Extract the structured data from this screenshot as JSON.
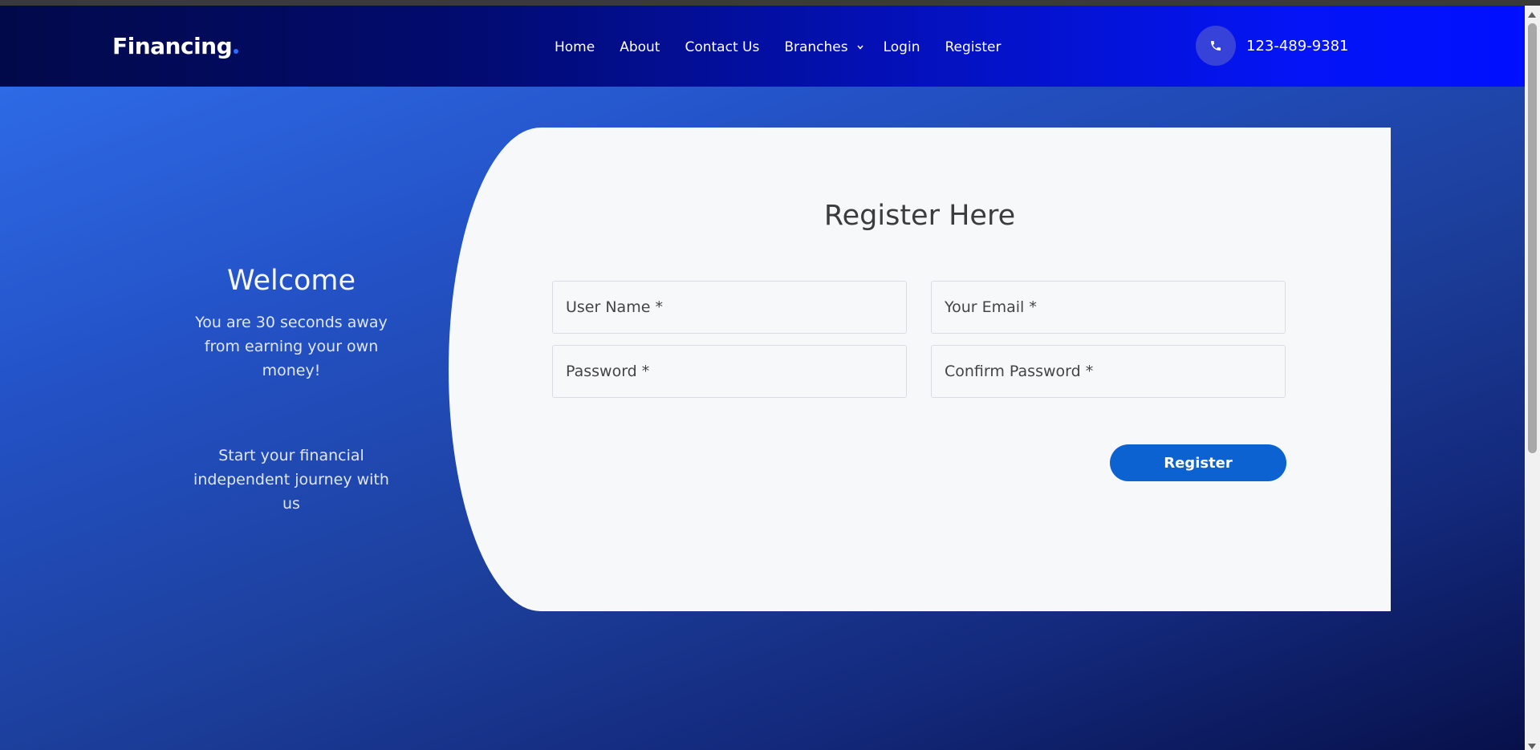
{
  "header": {
    "brand": "Financing",
    "nav": [
      "Home",
      "About",
      "Contact Us",
      "Branches",
      "Login",
      "Register"
    ],
    "phone": "123-489-9381"
  },
  "hero": {
    "welcome": "Welcome",
    "tagline": "You are 30 seconds away from earning your own money!",
    "journey": "Start your financial independent journey with us"
  },
  "form": {
    "title": "Register Here",
    "user_placeholder": "User Name *",
    "email_placeholder": "Your Email *",
    "password_placeholder": "Password *",
    "confirm_placeholder": "Confirm Password *",
    "submit_label": "Register"
  },
  "colors": {
    "accent": "#0b62d0",
    "header_start": "#02094a",
    "header_end": "#0010ff",
    "card_bg": "#f7f8fa"
  }
}
